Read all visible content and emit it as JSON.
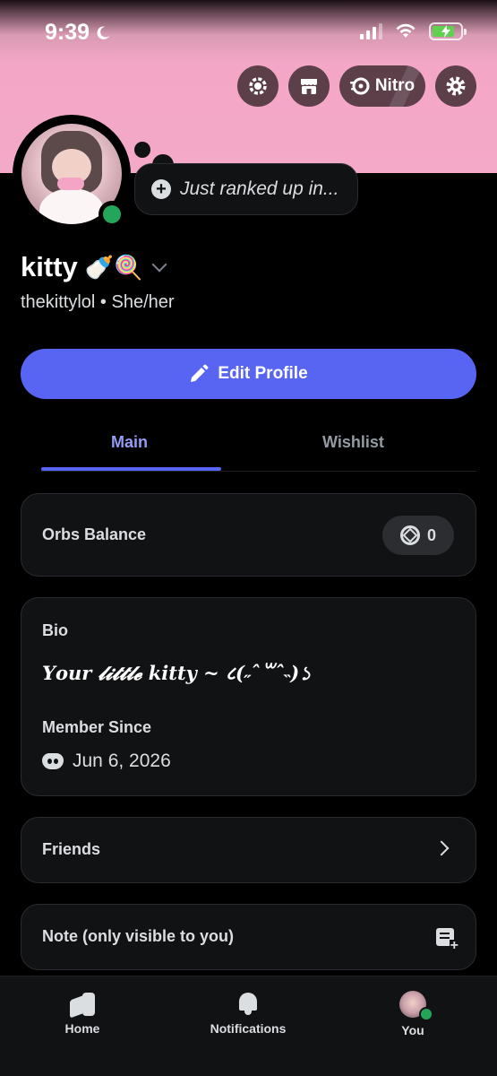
{
  "status_bar": {
    "time": "9:39"
  },
  "header": {
    "nitro_label": "Nitro"
  },
  "profile": {
    "custom_status": "Just ranked up in...",
    "display_name": "kitty",
    "display_name_emoji": "🍼🍭",
    "username_line": "thekittylol • She/her",
    "edit_button_label": "Edit Profile"
  },
  "tabs": [
    {
      "label": "Main",
      "active": true
    },
    {
      "label": "Wishlist",
      "active": false
    }
  ],
  "orbs": {
    "label": "Orbs Balance",
    "value": "0"
  },
  "bio": {
    "label": "Bio",
    "text": "𝒀𝒐𝒖𝒓 𝓵𝓲𝓽𝓽𝓵𝓮 𝒌𝒊𝒕𝒕𝒚 ~ ८(˶ˆ꒳ˆ˵)১",
    "member_since_label": "Member Since",
    "member_since_date": "Jun 6, 2026"
  },
  "friends": {
    "label": "Friends"
  },
  "note": {
    "label": "Note (only visible to you)"
  },
  "bottom_nav": [
    {
      "label": "Home",
      "icon": "home-icon"
    },
    {
      "label": "Notifications",
      "icon": "bell-icon"
    },
    {
      "label": "You",
      "icon": "avatar"
    }
  ],
  "colors": {
    "accent": "#5865f2",
    "banner": "#f5a9c9",
    "online": "#23a55a",
    "card": "#111214"
  }
}
